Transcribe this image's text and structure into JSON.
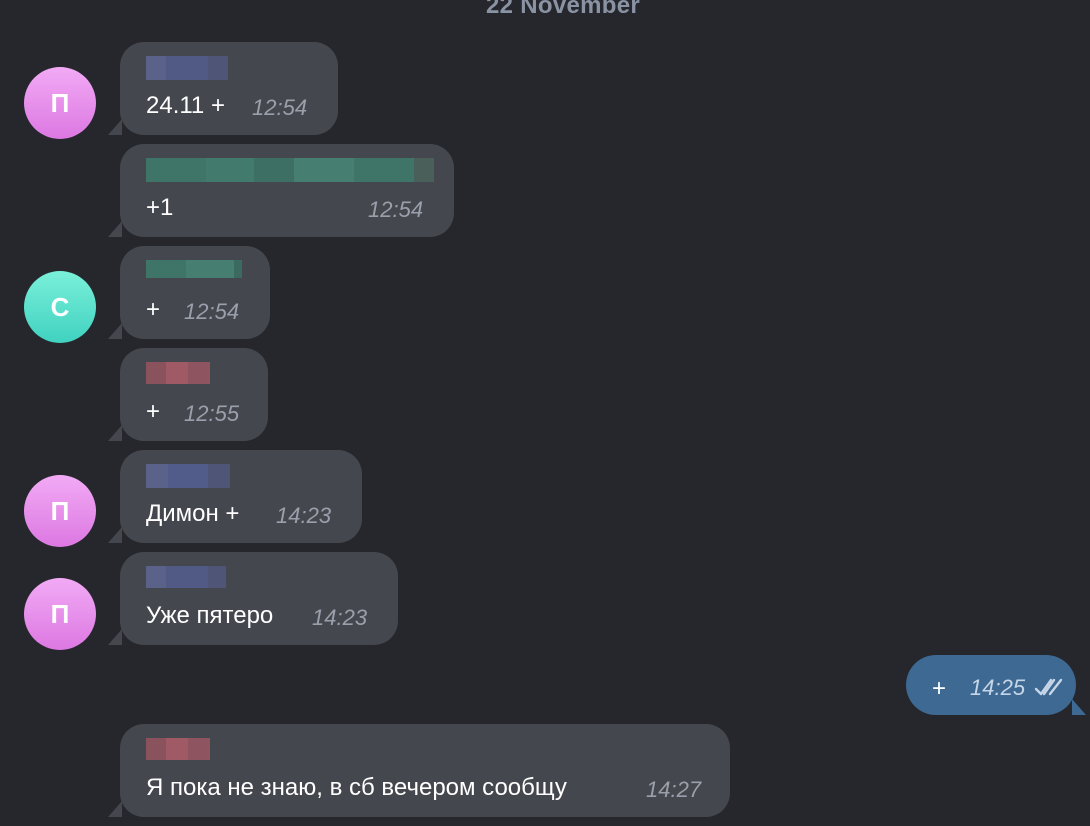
{
  "chat": {
    "date_header": "22 November",
    "messages": [
      {
        "text": "24.11 +",
        "time": "12:54",
        "avatar_letter": "П",
        "avatar_color": "#e488e9"
      },
      {
        "text": "+1",
        "time": "12:54"
      },
      {
        "text": "+",
        "time": "12:54",
        "avatar_letter": "С",
        "avatar_color": "#56e2cd"
      },
      {
        "text": "+",
        "time": "12:55"
      },
      {
        "text": "Димон +",
        "time": "14:23",
        "avatar_letter": "П",
        "avatar_color": "#e488e9"
      },
      {
        "text": "Уже пятеро",
        "time": "14:23",
        "avatar_letter": "П",
        "avatar_color": "#e488e9"
      },
      {
        "text": "Я пока не знаю, в сб вечером сообщу",
        "time": "14:27"
      }
    ],
    "outgoing": {
      "text": "+",
      "time": "14:25",
      "status_icon": "double-check-icon"
    }
  },
  "colors": {
    "background": "#26272c",
    "incoming_bubble": "#45474e",
    "outgoing_bubble": "#3d6993"
  }
}
